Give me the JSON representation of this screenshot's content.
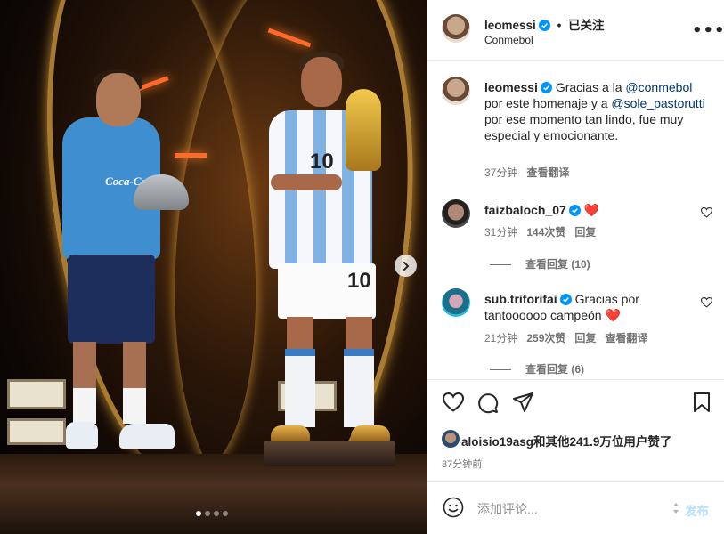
{
  "post": {
    "username": "leomessi",
    "follow_dot": "•",
    "follow_status": "已关注",
    "location": "Conmebol",
    "more_label": "•••"
  },
  "caption": {
    "username": "leomessi",
    "text_1": "Gracias a la ",
    "mention_1": "@conmebol",
    "text_2": " por este homenaje y a ",
    "mention_2": "@sole_pastorutti",
    "text_3": " por ese momento tan lindo, fue muy especial y emocionante.",
    "time": "37分钟",
    "translate": "查看翻译"
  },
  "comments": [
    {
      "username": "faizbaloch_07",
      "text": "❤️",
      "time": "31分钟",
      "likes": "144次赞",
      "reply": "回复",
      "view_replies": "查看回复 (10)"
    },
    {
      "username": "sub.triforifai",
      "text": "Gracias por tantoooooo campeón ❤️",
      "time": "21分钟",
      "likes": "259次赞",
      "reply": "回复",
      "translate": "查看翻译",
      "view_replies": "查看回复 (6)"
    }
  ],
  "media": {
    "jersey_number": "10",
    "sponsor_text": "Coca-Cola",
    "dots_total": 4,
    "dots_active_index": 0
  },
  "footer": {
    "likes_text": "aloisio19asg和其他241.9万位用户赞了",
    "time_ago": "37分钟前",
    "comment_placeholder": "添加评论...",
    "post_label": "发布"
  },
  "colors": {
    "verified_blue": "#0095f6",
    "heart_red": "#ed4956",
    "link_blue": "#00376b",
    "post_disabled": "#b2dffc"
  }
}
